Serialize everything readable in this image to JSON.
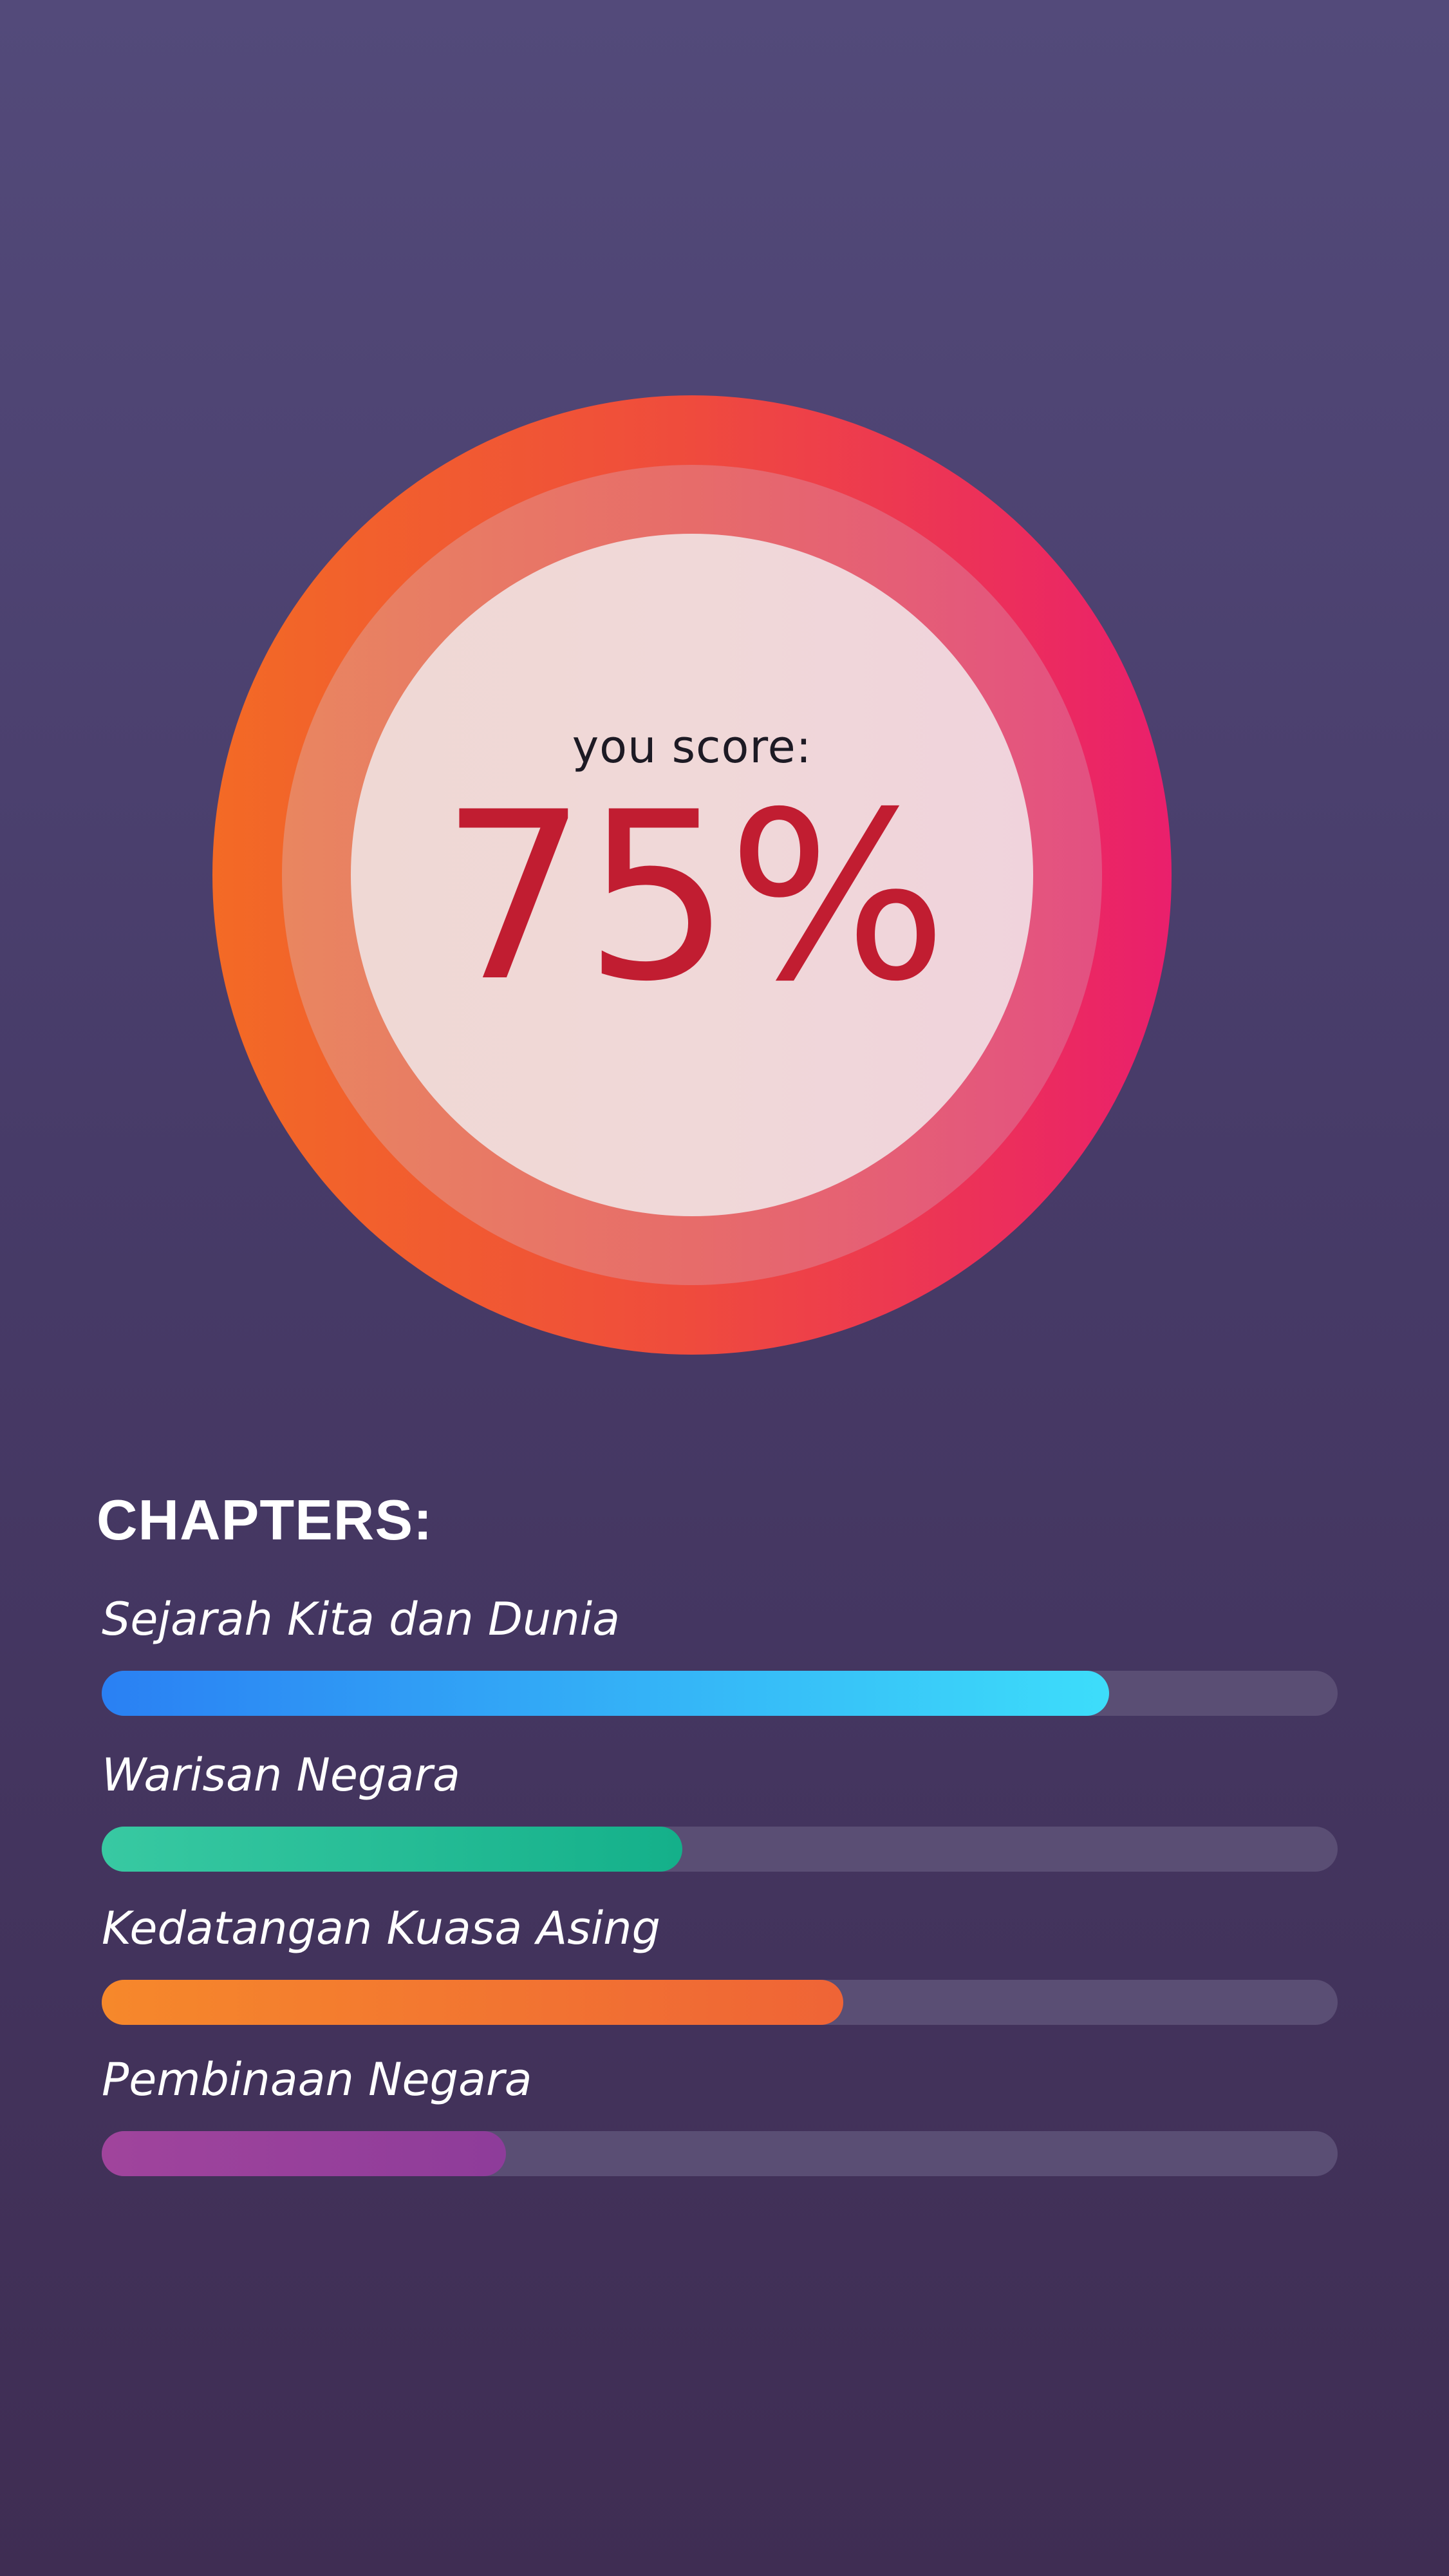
{
  "score": {
    "label": "you score:",
    "value": "75%",
    "percent": 75
  },
  "chapters_title": "CHAPTERS:",
  "chapters": [
    {
      "label": "Sejarah Kita dan Dunia",
      "progress": 0.815,
      "color_start": "#2a80f3",
      "color_end": "#3dddfa"
    },
    {
      "label": "Warisan Negara",
      "progress": 0.47,
      "color_start": "#38c9a2",
      "color_end": "#14b08a"
    },
    {
      "label": "Kedatangan Kuasa Asing",
      "progress": 0.6,
      "color_start": "#f6882b",
      "color_end": "#ef6436"
    },
    {
      "label": "Pembinaan Negara",
      "progress": 0.327,
      "color_start": "#a0449c",
      "color_end": "#8e3c9a"
    }
  ],
  "colors": {
    "background_top": "#534a7a",
    "background_bottom": "#3f2d53",
    "score_text": "#c11d31",
    "track": "#5a4e74"
  }
}
